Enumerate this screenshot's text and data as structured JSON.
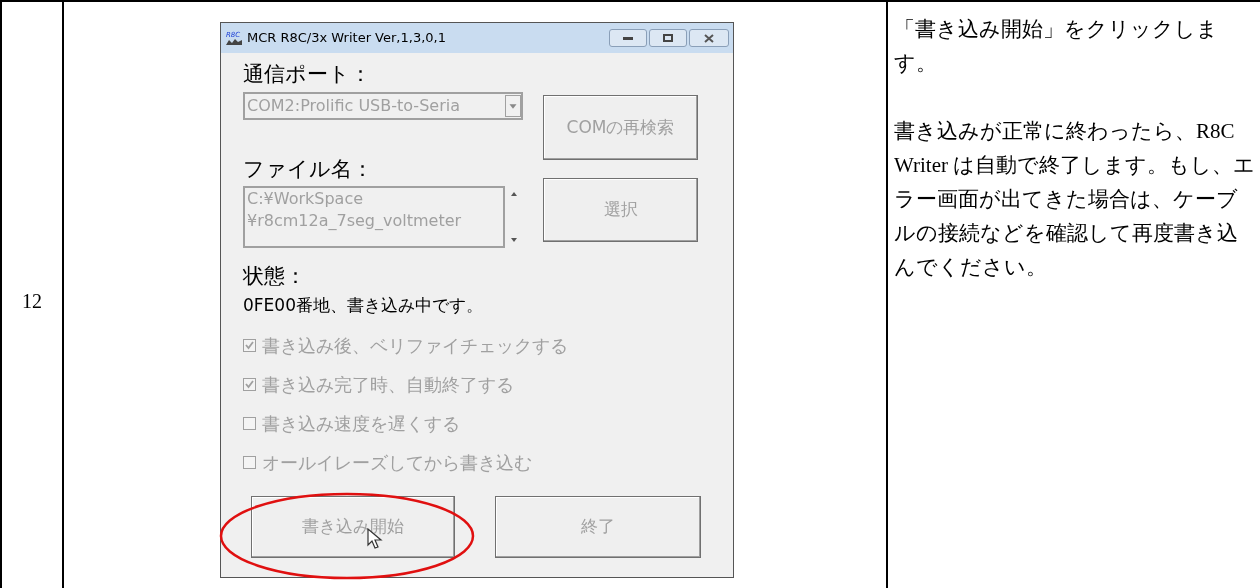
{
  "step": {
    "number": "12",
    "window": {
      "logo_text": "R8C",
      "title": "MCR R8C/3x Writer Ver,1,3,0,1",
      "port_label": "通信ポート：",
      "port_select": {
        "value": "COM2:Prolific USB-to-Seria",
        "disabled": true
      },
      "rescan_button": {
        "label": "COMの再検索",
        "disabled": true
      },
      "file_label": "ファイル名：",
      "file_field": {
        "lines": [
          "C:¥WorkSpace",
          "¥r8cm12a_7seg_voltmeter"
        ],
        "disabled": true
      },
      "select_button": {
        "label": "選択",
        "disabled": true
      },
      "status_label": "状態：",
      "status_text": "0FE00番地、書き込み中です。",
      "options": [
        {
          "label": "書き込み後、ベリファイチェックする",
          "checked": true,
          "disabled": true
        },
        {
          "label": "書き込み完了時、自動終了する",
          "checked": true,
          "disabled": true
        },
        {
          "label": "書き込み速度を遅くする",
          "checked": false,
          "disabled": true
        },
        {
          "label": "オールイレーズしてから書き込む",
          "checked": false,
          "disabled": true
        }
      ],
      "start_button": {
        "label": "書き込み開始",
        "disabled": true,
        "circled": true
      },
      "exit_button": {
        "label": "終了",
        "disabled": true
      }
    },
    "instructions": [
      "「書き込み開始」をクリックします。",
      "書き込みが正常に終わったら、R8C Writer は自動で終了します。もし、エラー画面が出てきた場合は、ケーブルの接続などを確認して再度書き込んでください。"
    ]
  }
}
